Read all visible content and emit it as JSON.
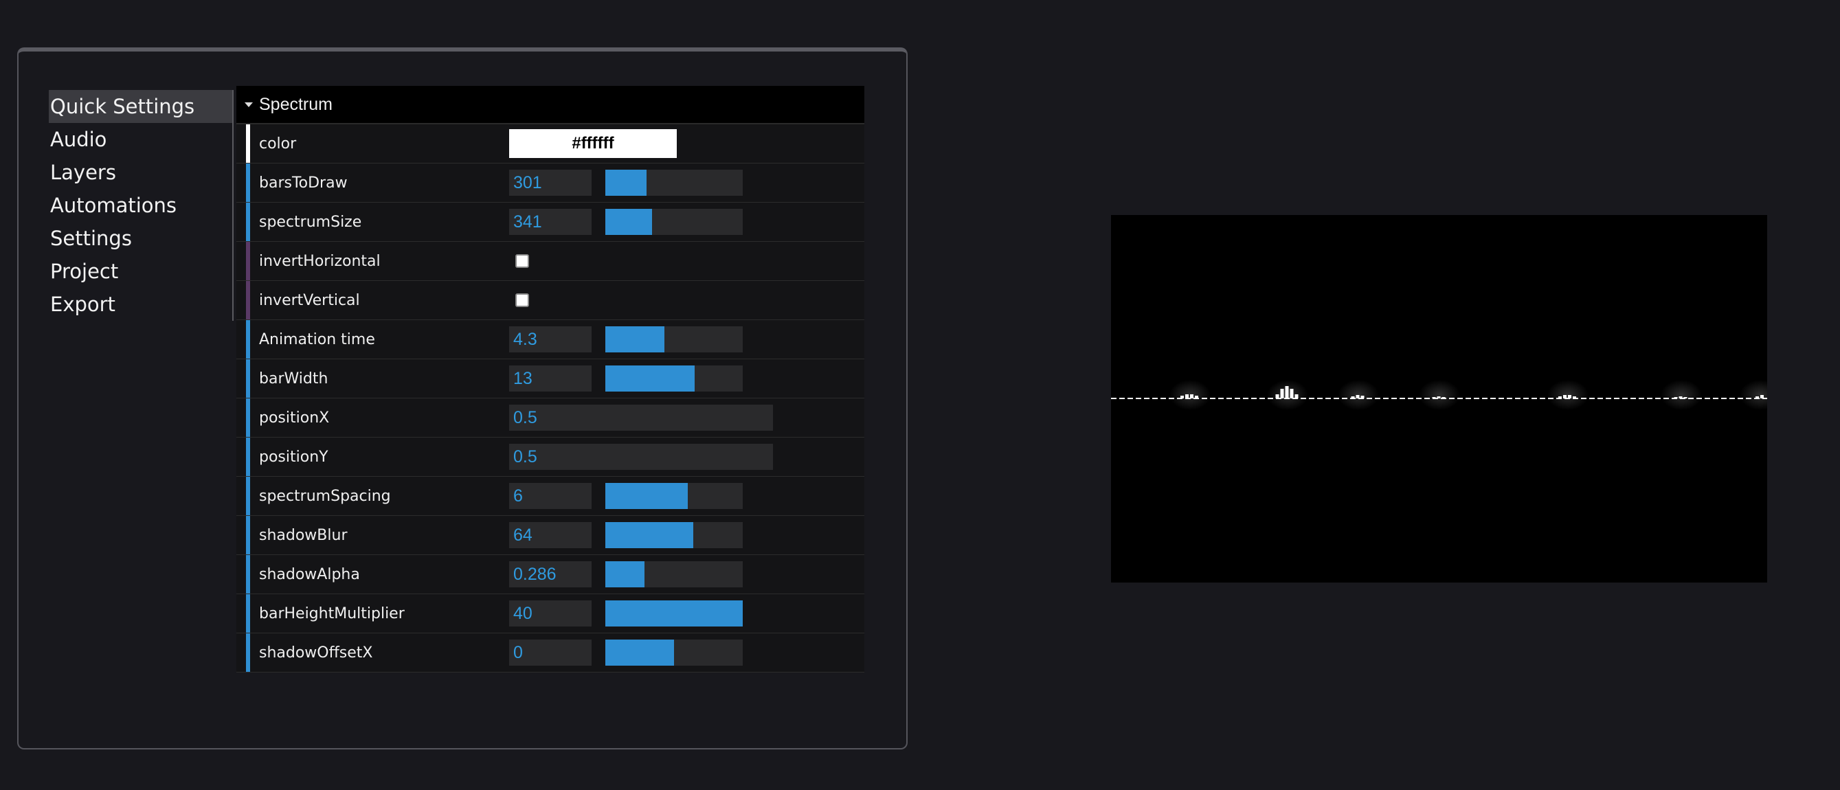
{
  "nav": {
    "items": [
      {
        "label": "Quick Settings"
      },
      {
        "label": "Audio"
      },
      {
        "label": "Layers"
      },
      {
        "label": "Automations"
      },
      {
        "label": "Settings"
      },
      {
        "label": "Project"
      },
      {
        "label": "Export"
      }
    ],
    "active_index": 0
  },
  "gui": {
    "folder_title": "Spectrum",
    "rows": [
      {
        "label": "color",
        "type": "color",
        "value": "#ffffff"
      },
      {
        "label": "barsToDraw",
        "type": "slider",
        "value": "301",
        "fraction": 0.3
      },
      {
        "label": "spectrumSize",
        "type": "slider",
        "value": "341",
        "fraction": 0.34
      },
      {
        "label": "invertHorizontal",
        "type": "checkbox",
        "checked": false
      },
      {
        "label": "invertVertical",
        "type": "checkbox",
        "checked": false
      },
      {
        "label": "Animation time",
        "type": "slider",
        "value": "4.3",
        "fraction": 0.43
      },
      {
        "label": "barWidth",
        "type": "slider",
        "value": "13",
        "fraction": 0.65
      },
      {
        "label": "positionX",
        "type": "number",
        "value": "0.5"
      },
      {
        "label": "positionY",
        "type": "number",
        "value": "0.5"
      },
      {
        "label": "spectrumSpacing",
        "type": "slider",
        "value": "6",
        "fraction": 0.6
      },
      {
        "label": "shadowBlur",
        "type": "slider",
        "value": "64",
        "fraction": 0.64
      },
      {
        "label": "shadowAlpha",
        "type": "slider",
        "value": "0.286",
        "fraction": 0.286
      },
      {
        "label": "barHeightMultiplier",
        "type": "slider",
        "value": "40",
        "fraction": 1.0
      },
      {
        "label": "shadowOffsetX",
        "type": "slider",
        "value": "0",
        "fraction": 0.5
      }
    ]
  },
  "colors": {
    "accent": "#2f8fd3",
    "value_text": "#2f9be0",
    "background": "#18181d"
  }
}
